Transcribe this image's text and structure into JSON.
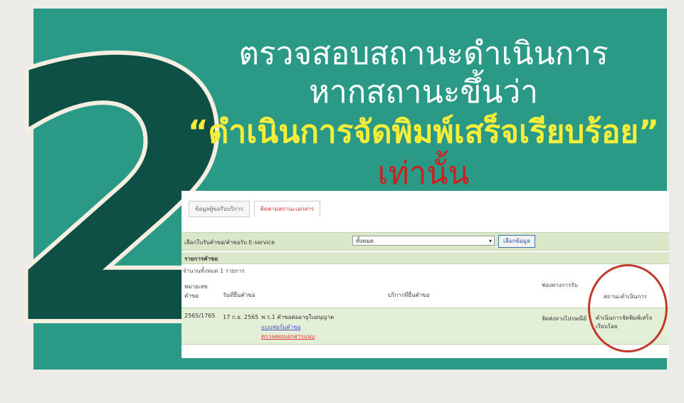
{
  "big_number": "2",
  "headline": {
    "line1": "ตรวจสอบสถานะดำเนินการ",
    "line2": "หากสถานะขึ้นว่า",
    "line3": "“ดำเนินการจัดพิมพ์เสร็จเรียบร้อย”",
    "line4": "เท่านั้น"
  },
  "screenshot": {
    "tabs": [
      {
        "label": "ข้อมูลผู้ขอรับบริการ"
      },
      {
        "label": "ติดตามสถานะเอกสาร"
      }
    ],
    "filter_label": "เลือกใบรับคำขอ/คำขอรับ E-service",
    "select_value": "ทั้งหมด",
    "search_button": "เลือกข้อมูล",
    "section_title": "รายการคำขอ",
    "count_text": "จำนวนทั้งหมด 1 รายการ",
    "columns": {
      "request_no": "หมายเลขคำขอ",
      "date": "วันที่ยื่นคำขอ",
      "service": "บริการที่ยื่นคำขอ",
      "channel": "ช่องทางการรับ",
      "status": "สถานะดำเนินการ"
    },
    "row": {
      "request_no": "2565/1765",
      "date": "17 ก.ย. 2565",
      "service_main": "พ.ร.1 คำขอต่ออายุใบอนุญาต",
      "service_link1": "แบบฟอร์มคำขอ",
      "service_link2": "ตรวจสอบเอกสารแนบ",
      "channel": "จัดส่งทางไปรษณีย์",
      "status": "ดำเนินการจัดพิมพ์เสร็จเรียบร้อย"
    }
  },
  "colors": {
    "panel": "#2a9a87",
    "big_number": "#0f5046",
    "highlight": "#f7ee3a",
    "emphasis": "#cc2020"
  }
}
